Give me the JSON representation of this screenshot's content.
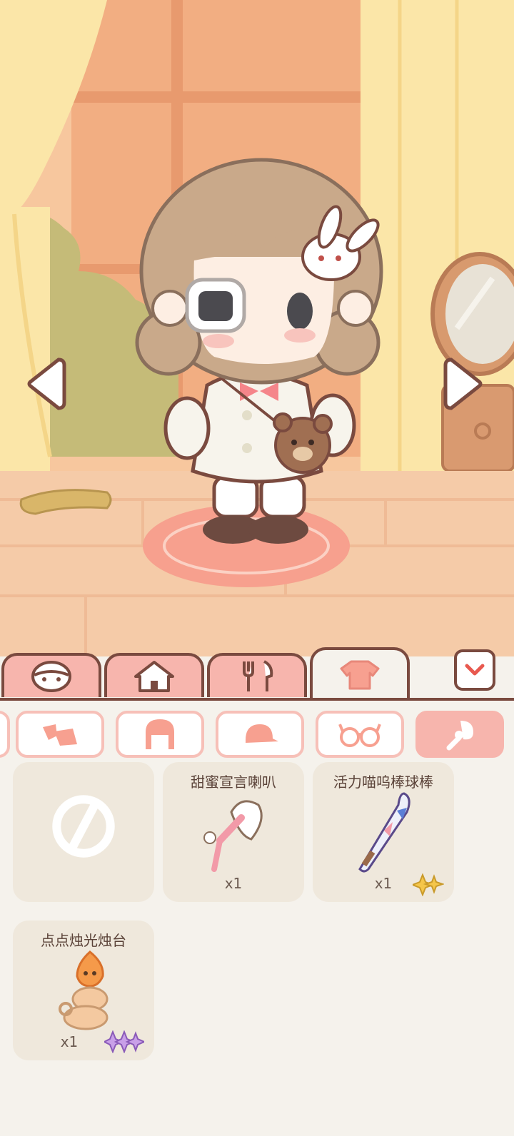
{
  "tabs": [
    {
      "key": "character",
      "icon": "face-icon"
    },
    {
      "key": "room",
      "icon": "house-icon"
    },
    {
      "key": "food",
      "icon": "cutlery-icon"
    },
    {
      "key": "clothing",
      "icon": "shirt-icon",
      "active": true
    }
  ],
  "categories": [
    {
      "key": "shoes",
      "icon": "shoes-icon"
    },
    {
      "key": "hair",
      "icon": "hair-icon"
    },
    {
      "key": "hat",
      "icon": "hat-icon"
    },
    {
      "key": "glasses",
      "icon": "glasses-icon"
    },
    {
      "key": "handheld",
      "icon": "handheld-item-icon",
      "active": true
    }
  ],
  "items": [
    {
      "name": "",
      "qty": "",
      "icon": "none-icon"
    },
    {
      "name": "甜蜜宣言喇叭",
      "qty": "x1",
      "icon": "megaphone-icon"
    },
    {
      "name": "活力喵呜棒球棒",
      "qty": "x1",
      "icon": "baseball-bat-icon",
      "rarity": "gold-sparkle"
    },
    {
      "name": "点点烛光烛台",
      "qty": "x1",
      "icon": "candle-holder-icon",
      "rarity": "purple-sparkle"
    }
  ],
  "colors": {
    "tab_bg": "#f7b5ad",
    "outline": "#7a4a3f",
    "panel_bg": "#f5f2ec",
    "card_bg": "#efe8dc",
    "accent": "#e8594f"
  }
}
